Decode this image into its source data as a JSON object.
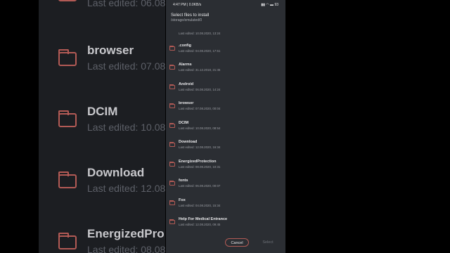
{
  "status_bar": {
    "time": "4:47 PM | 0.0KB/s",
    "right": "93"
  },
  "dialog": {
    "title": "Select files to install",
    "path": "/storage/emulated/0",
    "items": [
      {
        "name": "",
        "date": "Last edited: 10.08.2020, 13:24"
      },
      {
        "name": ".config",
        "date": "Last edited: 04.08.2020, 17:51"
      },
      {
        "name": "Alarms",
        "date": "Last edited: 31.12.2018, 21:45"
      },
      {
        "name": "Android",
        "date": "Last edited: 06.08.2020, 14:24"
      },
      {
        "name": "browser",
        "date": "Last edited: 07.08.2020, 00:04"
      },
      {
        "name": "DCIM",
        "date": "Last edited: 10.08.2020, 08:54"
      },
      {
        "name": "Download",
        "date": "Last edited: 12.08.2020, 16:34"
      },
      {
        "name": "EnergizedProtection",
        "date": "Last edited: 08.08.2020, 10:31"
      },
      {
        "name": "fonts",
        "date": "Last edited: 06.08.2020, 00:07"
      },
      {
        "name": "Fox",
        "date": "Last edited: 04.08.2020, 15:34"
      },
      {
        "name": "Help For Medical Entrance",
        "date": "Last edited: 12.08.2020, 09:45"
      }
    ],
    "cancel_label": "Cancel",
    "select_label": "Select"
  },
  "background_zoom": {
    "items": [
      {
        "name": "",
        "date": "Last edited: 06.08"
      },
      {
        "name": "browser",
        "date": "Last edited: 07.08"
      },
      {
        "name": "DCIM",
        "date": "Last edited: 10.08"
      },
      {
        "name": "Download",
        "date": "Last edited: 12.08"
      },
      {
        "name": "EnergizedPro",
        "date": "Last edited: 08.08"
      }
    ]
  }
}
